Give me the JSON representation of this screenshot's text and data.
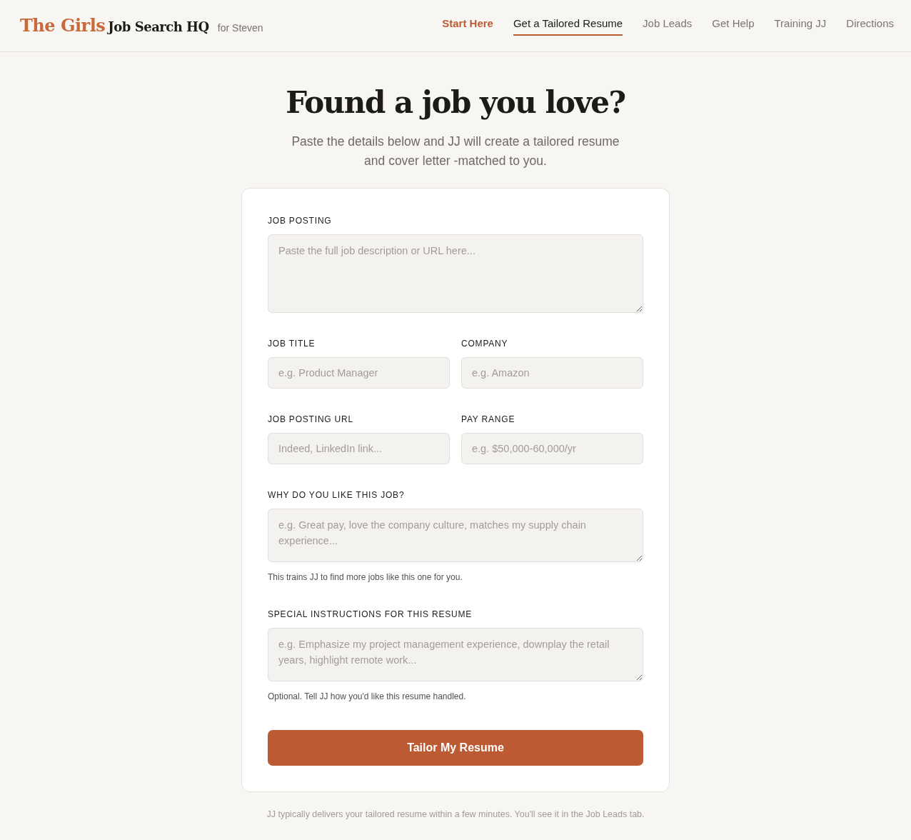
{
  "brand": {
    "accent": "The Girls",
    "name": "Job Search HQ",
    "user": "for Steven"
  },
  "nav": [
    {
      "label": "Start Here",
      "kind": "highlight",
      "selected": false
    },
    {
      "label": "Get a Tailored Resume",
      "kind": "link",
      "selected": true
    },
    {
      "label": "Job Leads",
      "kind": "link",
      "selected": false
    },
    {
      "label": "Get Help",
      "kind": "link",
      "selected": false
    },
    {
      "label": "Training JJ",
      "kind": "link",
      "selected": false
    },
    {
      "label": "Directions",
      "kind": "link",
      "selected": false
    }
  ],
  "heading": "Found a job you love?",
  "intro": [
    "Paste the details below and JJ will create a tailored resume",
    "and cover letter -matched to you."
  ],
  "form": {
    "rows": [
      {
        "fields": [
          {
            "label": "JOB POSTING",
            "kind": "textarea-large",
            "placeholder": "Paste the full job description or URL here..."
          }
        ]
      },
      {
        "fields": [
          {
            "label": "JOB TITLE",
            "kind": "input",
            "placeholder": "e.g. Product Manager"
          },
          {
            "label": "COMPANY",
            "kind": "input",
            "placeholder": "e.g. Amazon"
          }
        ]
      },
      {
        "fields": [
          {
            "label": "JOB POSTING URL",
            "kind": "input",
            "placeholder": "Indeed, LinkedIn link..."
          },
          {
            "label": "PAY RANGE",
            "kind": "input",
            "placeholder": "e.g. $50,000-60,000/yr"
          }
        ]
      },
      {
        "fields": [
          {
            "label": "WHY DO YOU LIKE THIS JOB?",
            "kind": "textarea",
            "placeholder": "e.g. Great pay, love the company culture, matches my supply chain experience...",
            "help": "This trains JJ to find more jobs like this one for you."
          }
        ]
      },
      {
        "fields": [
          {
            "label": "SPECIAL INSTRUCTIONS FOR THIS RESUME",
            "kind": "textarea",
            "placeholder": "e.g. Emphasize my project management experience, downplay the retail years, highlight remote work...",
            "help": "Optional. Tell JJ how you'd like this resume handled."
          }
        ]
      }
    ],
    "submit": "Tailor My Resume"
  },
  "footnote": "JJ typically delivers your tailored resume within a few minutes. You'll see it in the Job Leads tab."
}
